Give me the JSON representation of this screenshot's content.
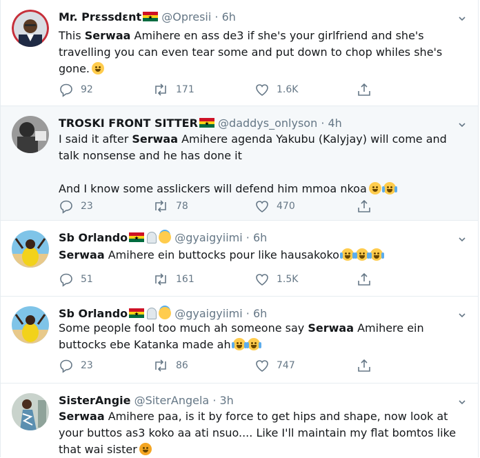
{
  "tweets": [
    {
      "name": "Mr. Prɛssdɛnt",
      "handle": "@Opresii",
      "dot": "·",
      "time": "6h",
      "text_pre": "This ",
      "text_bold": "Serwaa",
      "text_post": " Amihere en ass de3 if she's your girlfriend and she's travelling you can even tear some and put down to chop whiles she's gone.",
      "replies": "92",
      "retweets": "171",
      "likes": "1.6K",
      "avatar_icon": "president-avatar"
    },
    {
      "name": "TROSKI FRONT SITTER",
      "handle": "@daddys_onlyson",
      "dot": "·",
      "time": "4h",
      "text_pre": "I said it after ",
      "text_bold": "Serwaa",
      "text_post": " Amihere agenda Yakubu (Kalyjay) will come and talk nonsense and he has done it",
      "text_second": "And I know some asslickers will defend him mmoa nkoa",
      "replies": "23",
      "retweets": "78",
      "likes": "470",
      "avatar_icon": "child-avatar"
    },
    {
      "name": "Sb Orlando",
      "handle": "@gyaigyiimi",
      "dot": "·",
      "time": "6h",
      "text_pre": "",
      "text_bold": "Serwaa",
      "text_post": " Amihere ein buttocks pour like hausakoko",
      "replies": "51",
      "retweets": "161",
      "likes": "1.5K",
      "avatar_icon": "beach-avatar"
    },
    {
      "name": "Sb Orlando",
      "handle": "@gyaigyiimi",
      "dot": "·",
      "time": "6h",
      "text_pre": "Some people fool too much ah someone say ",
      "text_bold": "Serwaa",
      "text_post": " Amihere ein buttocks ebe Katanka made ah",
      "replies": "23",
      "retweets": "86",
      "likes": "747",
      "avatar_icon": "beach-avatar"
    },
    {
      "name": "SisterAngie",
      "handle": "@SiterAngela",
      "dot": "·",
      "time": "3h",
      "text_pre": "",
      "text_bold": "Serwaa",
      "text_post": " Amihere paa, is it by force to get hips and shape, now look at your buttos as3 koko aa ati nsuo.... Like I'll maintain my flat bomtos like that wai sister",
      "avatar_icon": "woman-avatar"
    }
  ],
  "colors": {
    "text": "#14171a",
    "secondary": "#657786",
    "divider": "#e6ecf0",
    "highlight_bg": "#f5f8fa",
    "ghana_red": "#ce1126",
    "ghana_gold": "#fcd116",
    "ghana_green": "#006b3f"
  }
}
